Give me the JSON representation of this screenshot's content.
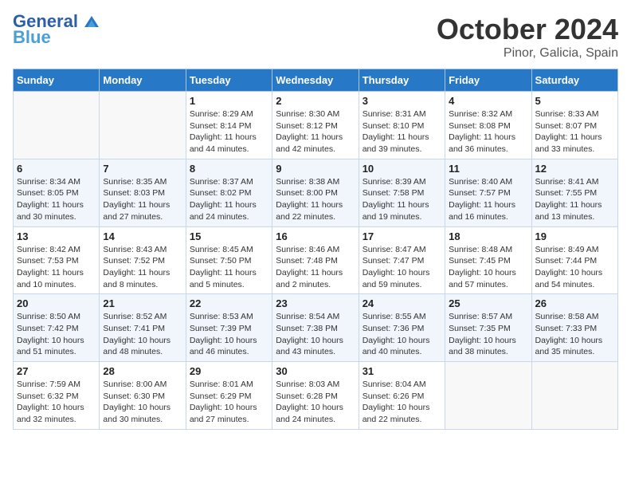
{
  "header": {
    "logo_line1": "General",
    "logo_line2": "Blue",
    "month": "October 2024",
    "location": "Pinor, Galicia, Spain"
  },
  "weekdays": [
    "Sunday",
    "Monday",
    "Tuesday",
    "Wednesday",
    "Thursday",
    "Friday",
    "Saturday"
  ],
  "weeks": [
    [
      {
        "day": "",
        "info": ""
      },
      {
        "day": "",
        "info": ""
      },
      {
        "day": "1",
        "info": "Sunrise: 8:29 AM\nSunset: 8:14 PM\nDaylight: 11 hours and 44 minutes."
      },
      {
        "day": "2",
        "info": "Sunrise: 8:30 AM\nSunset: 8:12 PM\nDaylight: 11 hours and 42 minutes."
      },
      {
        "day": "3",
        "info": "Sunrise: 8:31 AM\nSunset: 8:10 PM\nDaylight: 11 hours and 39 minutes."
      },
      {
        "day": "4",
        "info": "Sunrise: 8:32 AM\nSunset: 8:08 PM\nDaylight: 11 hours and 36 minutes."
      },
      {
        "day": "5",
        "info": "Sunrise: 8:33 AM\nSunset: 8:07 PM\nDaylight: 11 hours and 33 minutes."
      }
    ],
    [
      {
        "day": "6",
        "info": "Sunrise: 8:34 AM\nSunset: 8:05 PM\nDaylight: 11 hours and 30 minutes."
      },
      {
        "day": "7",
        "info": "Sunrise: 8:35 AM\nSunset: 8:03 PM\nDaylight: 11 hours and 27 minutes."
      },
      {
        "day": "8",
        "info": "Sunrise: 8:37 AM\nSunset: 8:02 PM\nDaylight: 11 hours and 24 minutes."
      },
      {
        "day": "9",
        "info": "Sunrise: 8:38 AM\nSunset: 8:00 PM\nDaylight: 11 hours and 22 minutes."
      },
      {
        "day": "10",
        "info": "Sunrise: 8:39 AM\nSunset: 7:58 PM\nDaylight: 11 hours and 19 minutes."
      },
      {
        "day": "11",
        "info": "Sunrise: 8:40 AM\nSunset: 7:57 PM\nDaylight: 11 hours and 16 minutes."
      },
      {
        "day": "12",
        "info": "Sunrise: 8:41 AM\nSunset: 7:55 PM\nDaylight: 11 hours and 13 minutes."
      }
    ],
    [
      {
        "day": "13",
        "info": "Sunrise: 8:42 AM\nSunset: 7:53 PM\nDaylight: 11 hours and 10 minutes."
      },
      {
        "day": "14",
        "info": "Sunrise: 8:43 AM\nSunset: 7:52 PM\nDaylight: 11 hours and 8 minutes."
      },
      {
        "day": "15",
        "info": "Sunrise: 8:45 AM\nSunset: 7:50 PM\nDaylight: 11 hours and 5 minutes."
      },
      {
        "day": "16",
        "info": "Sunrise: 8:46 AM\nSunset: 7:48 PM\nDaylight: 11 hours and 2 minutes."
      },
      {
        "day": "17",
        "info": "Sunrise: 8:47 AM\nSunset: 7:47 PM\nDaylight: 10 hours and 59 minutes."
      },
      {
        "day": "18",
        "info": "Sunrise: 8:48 AM\nSunset: 7:45 PM\nDaylight: 10 hours and 57 minutes."
      },
      {
        "day": "19",
        "info": "Sunrise: 8:49 AM\nSunset: 7:44 PM\nDaylight: 10 hours and 54 minutes."
      }
    ],
    [
      {
        "day": "20",
        "info": "Sunrise: 8:50 AM\nSunset: 7:42 PM\nDaylight: 10 hours and 51 minutes."
      },
      {
        "day": "21",
        "info": "Sunrise: 8:52 AM\nSunset: 7:41 PM\nDaylight: 10 hours and 48 minutes."
      },
      {
        "day": "22",
        "info": "Sunrise: 8:53 AM\nSunset: 7:39 PM\nDaylight: 10 hours and 46 minutes."
      },
      {
        "day": "23",
        "info": "Sunrise: 8:54 AM\nSunset: 7:38 PM\nDaylight: 10 hours and 43 minutes."
      },
      {
        "day": "24",
        "info": "Sunrise: 8:55 AM\nSunset: 7:36 PM\nDaylight: 10 hours and 40 minutes."
      },
      {
        "day": "25",
        "info": "Sunrise: 8:57 AM\nSunset: 7:35 PM\nDaylight: 10 hours and 38 minutes."
      },
      {
        "day": "26",
        "info": "Sunrise: 8:58 AM\nSunset: 7:33 PM\nDaylight: 10 hours and 35 minutes."
      }
    ],
    [
      {
        "day": "27",
        "info": "Sunrise: 7:59 AM\nSunset: 6:32 PM\nDaylight: 10 hours and 32 minutes."
      },
      {
        "day": "28",
        "info": "Sunrise: 8:00 AM\nSunset: 6:30 PM\nDaylight: 10 hours and 30 minutes."
      },
      {
        "day": "29",
        "info": "Sunrise: 8:01 AM\nSunset: 6:29 PM\nDaylight: 10 hours and 27 minutes."
      },
      {
        "day": "30",
        "info": "Sunrise: 8:03 AM\nSunset: 6:28 PM\nDaylight: 10 hours and 24 minutes."
      },
      {
        "day": "31",
        "info": "Sunrise: 8:04 AM\nSunset: 6:26 PM\nDaylight: 10 hours and 22 minutes."
      },
      {
        "day": "",
        "info": ""
      },
      {
        "day": "",
        "info": ""
      }
    ]
  ]
}
